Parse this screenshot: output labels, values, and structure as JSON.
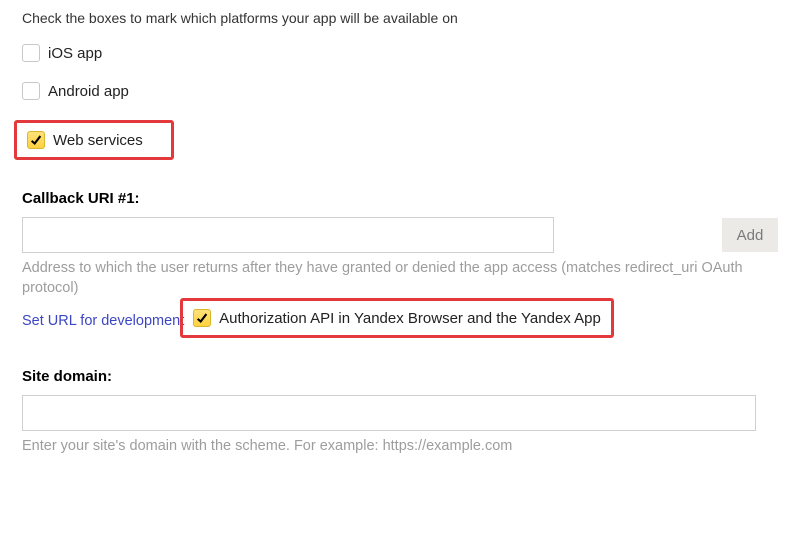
{
  "intro": "Check the boxes to mark which platforms your app will be available on",
  "platforms": {
    "ios": {
      "label": "iOS app",
      "checked": false
    },
    "android": {
      "label": "Android app",
      "checked": false
    },
    "web": {
      "label": "Web services",
      "checked": true
    },
    "auth_api": {
      "label": "Authorization API in Yandex Browser and the Yandex App",
      "checked": true
    }
  },
  "callback": {
    "label": "Callback URI #1:",
    "value": "",
    "add_label": "Add",
    "hint": "Address to which the user returns after they have granted or denied the app access (matches redirect_uri OAuth protocol)",
    "dev_link": "Set URL for development"
  },
  "site_domain": {
    "label": "Site domain:",
    "value": "",
    "hint": "Enter your site's domain with the scheme. For example: https://example.com"
  }
}
